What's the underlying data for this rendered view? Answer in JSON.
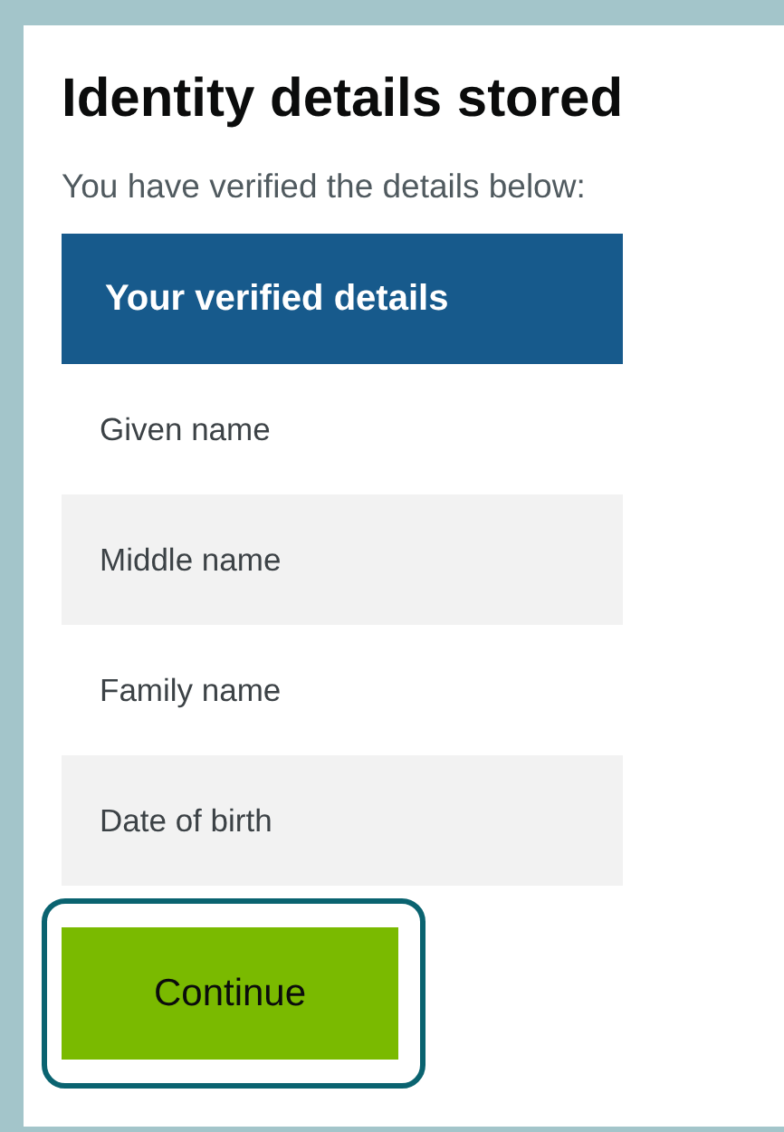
{
  "title": "Identity details stored",
  "intro": "You have verified the details below:",
  "details": {
    "heading": "Your verified details",
    "rows": [
      {
        "label": "Given name"
      },
      {
        "label": "Middle name"
      },
      {
        "label": "Family name"
      },
      {
        "label": "Date of birth"
      }
    ]
  },
  "button": {
    "label": "Continue",
    "focused": true
  }
}
